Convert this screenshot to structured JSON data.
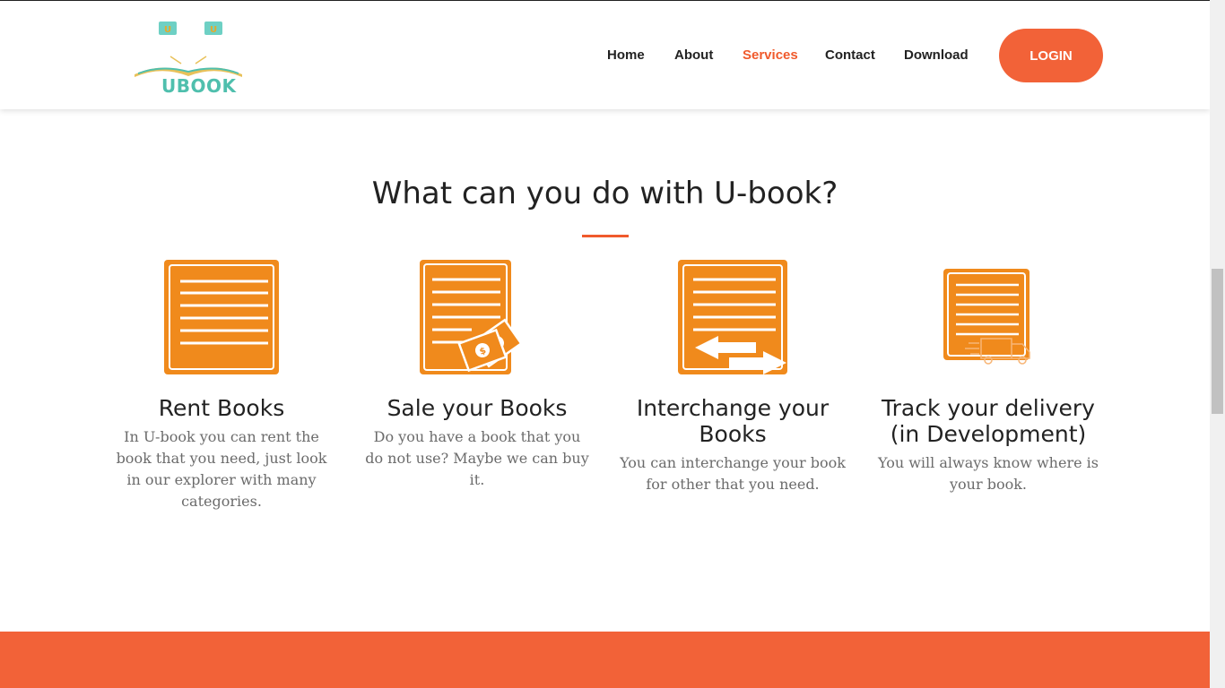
{
  "brand": {
    "logo_text": "UBOOK",
    "logo_mark": "U"
  },
  "nav": {
    "items": [
      {
        "label": "Home",
        "active": false
      },
      {
        "label": "About",
        "active": false
      },
      {
        "label": "Services",
        "active": true
      },
      {
        "label": "Contact",
        "active": false
      },
      {
        "label": "Download",
        "active": false
      }
    ],
    "login_label": "LOGIN"
  },
  "services": {
    "title": "What can you do with U-book?",
    "cards": [
      {
        "icon": "document-icon",
        "title": "Rent Books",
        "description": "In U-book you can rent the book that you need, just look in our explorer with many categories."
      },
      {
        "icon": "document-money-icon",
        "title": "Sale your Books",
        "description": "Do you have a book that you do not use? Maybe we can buy it."
      },
      {
        "icon": "document-exchange-icon",
        "title": "Interchange your Books",
        "description": "You can interchange your book for other that you need."
      },
      {
        "icon": "document-delivery-truck-icon",
        "title": "Track your delivery (in Development)",
        "description": "You will always know where is your book."
      }
    ]
  },
  "colors": {
    "accent": "#f26238",
    "icon_orange": "#f08a1c",
    "logo_teal": "#4fbfad",
    "text_dark": "#222222",
    "text_muted": "#6b6b6b"
  }
}
